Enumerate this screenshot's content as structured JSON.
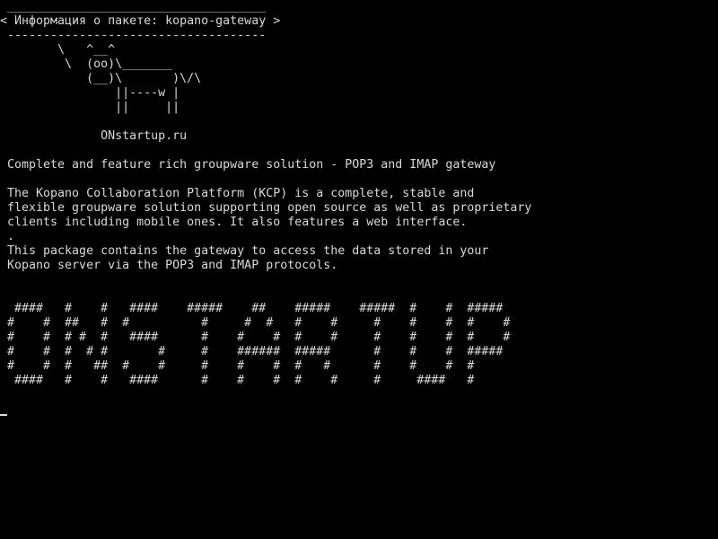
{
  "terminal": {
    "title_banner": {
      "top_rule": " ____________________________________",
      "title": "< Информация о пакете: kopano-gateway >",
      "bottom_rule": " ------------------------------------"
    },
    "cow_art": [
      "        \\   ^__^",
      "         \\  (oo)\\_______",
      "            (__)\\       )\\/\\",
      "                ||----w |",
      "                ||     ||"
    ],
    "site_label": "              ONstartup.ru",
    "description": [
      " Complete and feature rich groupware solution - POP3 and IMAP gateway",
      "",
      " The Kopano Collaboration Platform (KCP) is a complete, stable and",
      " flexible groupware solution supporting open source as well as proprietary",
      " clients including mobile ones. It also features a web interface.",
      " .",
      " This package contains the gateway to access the data stored in your",
      " Kopano server via the POP3 and IMAP protocols."
    ],
    "banner_art": [
      "  ####   #    #   ####    #####    ##    #####    #####  #    #  #####",
      " #    #  ##   #  #          #     #  #   #    #     #    #    #  #    #",
      " #    #  # #  #   ####      #    #    #  #    #     #    #    #  #    #",
      " #    #  #  # #       #     #    ######  #####      #    #    #  #####",
      " #    #  #   ##  #    #     #    #    #  #   #      #    #    #  #",
      "  ####   #    #   ####      #    #    #  #    #     #     ####   #"
    ]
  }
}
